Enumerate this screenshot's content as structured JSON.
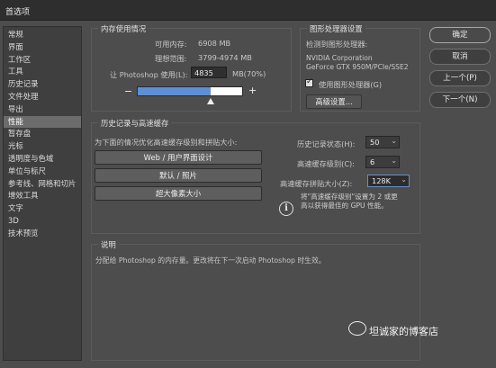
{
  "window": {
    "title": "首选项"
  },
  "sidebar": {
    "items": [
      {
        "label": "常规"
      },
      {
        "label": "界面"
      },
      {
        "label": "工作区"
      },
      {
        "label": "工具"
      },
      {
        "label": "历史记录"
      },
      {
        "label": "文件处理"
      },
      {
        "label": "导出"
      },
      {
        "label": "性能",
        "selected": true
      },
      {
        "label": "暂存盘"
      },
      {
        "label": "光标"
      },
      {
        "label": "透明度与色域"
      },
      {
        "label": "单位与标尺"
      },
      {
        "label": "参考线、网格和切片"
      },
      {
        "label": "增效工具"
      },
      {
        "label": "文字"
      },
      {
        "label": "3D"
      },
      {
        "label": "技术预览"
      }
    ]
  },
  "memory": {
    "title": "内存使用情况",
    "available_label": "可用内存:",
    "available_value": "6908 MB",
    "ideal_label": "理想范围:",
    "ideal_value": "3799-4974 MB",
    "usage_label": "让 Photoshop 使用(L):",
    "usage_value": "4835",
    "usage_unit": "MB(70%)",
    "minus": "−",
    "plus": "+",
    "slider_fraction": 0.7
  },
  "gpu": {
    "title": "图形处理器设置",
    "detected_label": "检测到图形处理器:",
    "vendor": "NVIDIA Corporation",
    "model": "GeForce GTX 950M/PCIe/SSE2",
    "use_gpu_label": "使用图形处理器(G)",
    "use_gpu_checked": true,
    "advanced_button": "高级设置..."
  },
  "history_cache": {
    "title": "历史记录与高速缓存",
    "optimize_label": "为下面的情况优化高速缓存级别和拼贴大小:",
    "preset_buttons": [
      "Web / 用户界面设计",
      "默认 / 照片",
      "超大像素大小"
    ],
    "history_states_label": "历史记录状态(H):",
    "history_states_value": "50",
    "cache_levels_label": "高速缓存级别(C):",
    "cache_levels_value": "6",
    "tile_size_label": "高速缓存拼贴大小(Z):",
    "tile_size_value": "128K",
    "info_icon": "i",
    "info_text_line1": "将\"高速缓存级别\"设置为 2 或更",
    "info_text_line2": "高以获得最佳的 GPU 性能。"
  },
  "description": {
    "title": "说明",
    "text": "分配给 Photoshop 的内存量。更改将在下一次启动 Photoshop 时生效。"
  },
  "actions": {
    "ok": "确定",
    "cancel": "取消",
    "prev": "上一个(P)",
    "next": "下一个(N)"
  },
  "watermark": {
    "text": "坦诚家的博客店"
  },
  "colors": {
    "accent": "#5e8fd6",
    "panel": "#4d4d4d",
    "sidebar_selected": "#6c6c6c"
  }
}
